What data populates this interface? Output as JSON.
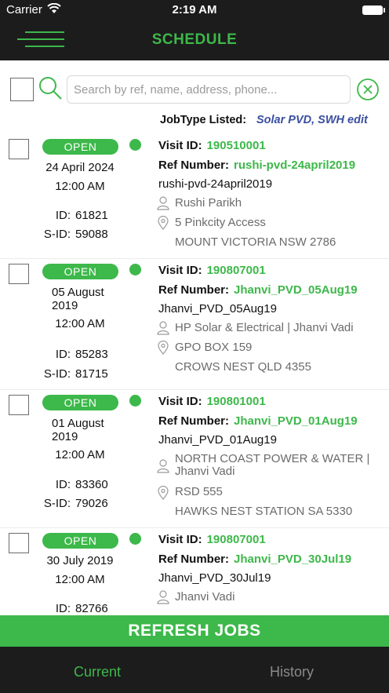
{
  "status_bar": {
    "carrier": "Carrier",
    "time": "2:19 AM"
  },
  "header": {
    "title": "SCHEDULE"
  },
  "search": {
    "placeholder": "Search by ref, name, address, phone..."
  },
  "filter": {
    "label": "JobType Listed:",
    "value": "Solar PVD, SWH",
    "edit_label": "edit"
  },
  "jobs": [
    {
      "status": "OPEN",
      "date": "24 April 2024",
      "time": "12:00 AM",
      "id_label": "ID:",
      "id": "61821",
      "sid_label": "S-ID:",
      "sid": "59088",
      "visit_label": "Visit ID:",
      "visit_id": "190510001",
      "ref_label": "Ref Number:",
      "ref_number": "rushi-pvd-24april2019",
      "title": "rushi-pvd-24april2019",
      "contact": "Rushi Parikh",
      "address1": "5 Pinkcity Access",
      "address2": "MOUNT VICTORIA NSW 2786"
    },
    {
      "status": "OPEN",
      "date_line1": "05 August",
      "date_line2": "2019",
      "time": "12:00 AM",
      "id_label": "ID:",
      "id": "85283",
      "sid_label": "S-ID:",
      "sid": "81715",
      "visit_label": "Visit ID:",
      "visit_id": "190807001",
      "ref_label": "Ref Number:",
      "ref_number": "Jhanvi_PVD_05Aug19",
      "title": "Jhanvi_PVD_05Aug19",
      "contact": "HP Solar & Electrical | Jhanvi Vadi",
      "address1": "GPO BOX 159",
      "address2": "CROWS NEST QLD 4355"
    },
    {
      "status": "OPEN",
      "date_line1": "01 August",
      "date_line2": "2019",
      "time": "12:00 AM",
      "id_label": "ID:",
      "id": "83360",
      "sid_label": "S-ID:",
      "sid": "79026",
      "visit_label": "Visit ID:",
      "visit_id": "190801001",
      "ref_label": "Ref Number:",
      "ref_number": "Jhanvi_PVD_01Aug19",
      "title": "Jhanvi_PVD_01Aug19",
      "contact_line1": "NORTH COAST POWER & WATER |",
      "contact_line2": "Jhanvi Vadi",
      "address1": "RSD 555",
      "address2": "HAWKS NEST STATION SA 5330"
    },
    {
      "status": "OPEN",
      "date": "30 July 2019",
      "time": "12:00 AM",
      "id_label": "ID:",
      "id": "82766",
      "visit_label": "Visit ID:",
      "visit_id": "190807001",
      "ref_label": "Ref Number:",
      "ref_number": "Jhanvi_PVD_30Jul19",
      "title": "Jhanvi_PVD_30Jul19",
      "contact": "Jhanvi Vadi"
    }
  ],
  "actions": {
    "refresh_label": "REFRESH JOBS"
  },
  "tabs": [
    {
      "label": "Current",
      "active": true
    },
    {
      "label": "History",
      "active": false
    }
  ],
  "theme": {
    "accent": "#3db84a",
    "dark": "#1c1c1c",
    "link": "#3a4fa0"
  },
  "icons": [
    "menu-icon",
    "search-icon",
    "clear-icon",
    "person-icon",
    "location-pin-icon",
    "wifi-icon",
    "battery-icon"
  ]
}
